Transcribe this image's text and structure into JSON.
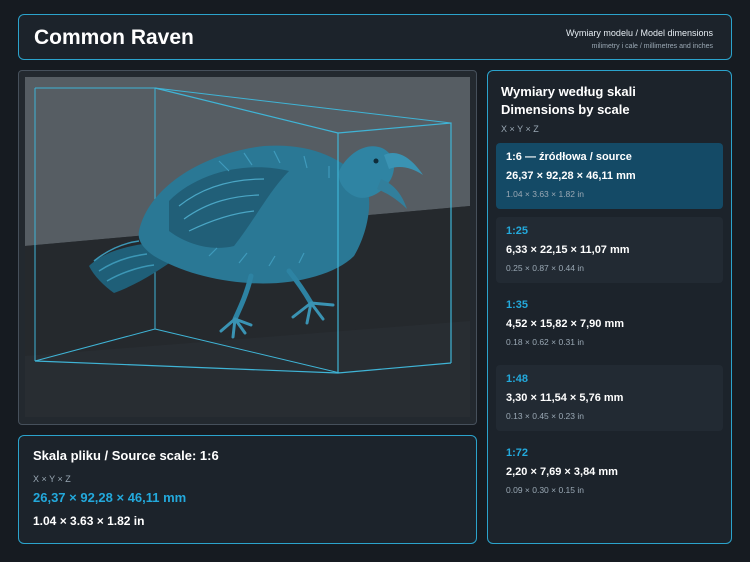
{
  "header": {
    "title": "Common Raven",
    "subtitle": "Wymiary modelu / Model dimensions",
    "units_note": "milimetry i cale / millimetres and inches"
  },
  "source": {
    "title": "Skala pliku / Source scale: 1:6",
    "axis": "X × Y × Z",
    "mm": "26,37 × 92,28 × 46,11 mm",
    "inches": "1.04 × 3.63 × 1.82 in"
  },
  "scales": {
    "title_pl": "Wymiary według skali",
    "title_en": "Dimensions by scale",
    "axis": "X × Y × Z",
    "items": [
      {
        "label": "1:6  —  źródłowa / source",
        "mm": "26,37 × 92,28 × 46,11 mm",
        "inches": "1.04 × 3.63 × 1.82 in",
        "selected": true
      },
      {
        "label": "1:25",
        "mm": "6,33 × 22,15 × 11,07 mm",
        "inches": "0.25 × 0.87 × 0.44 in",
        "selected": false
      },
      {
        "label": "1:35",
        "mm": "4,52 × 15,82 × 7,90 mm",
        "inches": "0.18 × 0.62 × 0.31 in",
        "selected": false
      },
      {
        "label": "1:48",
        "mm": "3,30 × 11,54 × 5,76 mm",
        "inches": "0.13 × 0.45 × 0.23 in",
        "selected": false
      },
      {
        "label": "1:72",
        "mm": "2,20 × 7,69 × 3,84 mm",
        "inches": "0.09 × 0.30 × 0.15 in",
        "selected": false
      }
    ]
  },
  "colors": {
    "accent": "#2ba3cc",
    "value_blue": "#23a9dc",
    "selected_row": "#144a66",
    "model": "#2e7e9c",
    "background": "#161b21"
  },
  "viewport": {
    "model_icon": "raven-model"
  }
}
